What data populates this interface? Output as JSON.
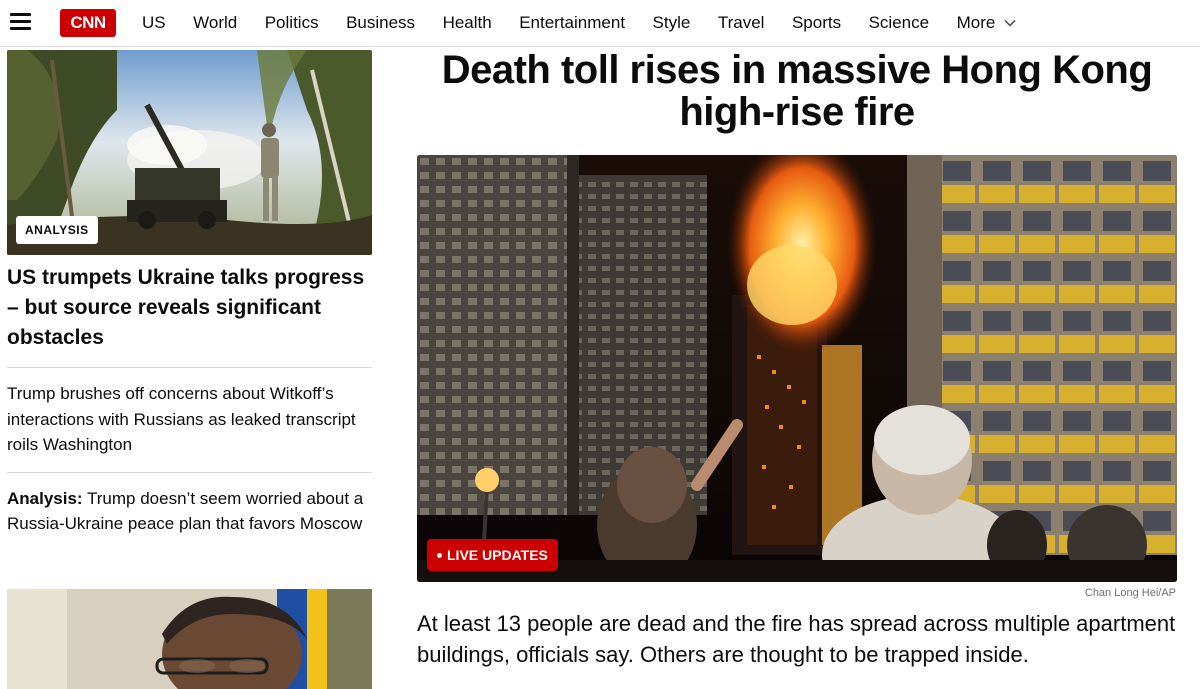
{
  "brand": {
    "color": "#cc0000",
    "logo_text": "CNN"
  },
  "nav": {
    "items": [
      "US",
      "World",
      "Politics",
      "Business",
      "Health",
      "Entertainment",
      "Style",
      "Travel",
      "Sports",
      "Science"
    ],
    "more_label": "More",
    "menu_icon": "hamburger-menu-icon",
    "more_icon": "chevron-down-icon"
  },
  "left_column": {
    "lead": {
      "badge": "ANALYSIS",
      "title": "US trumpets Ukraine talks progress – but source reveals significant obstacles"
    },
    "stories": [
      {
        "prefix": "",
        "text": "Trump brushes off concerns about Witkoff’s interactions with Russians as leaked transcript roils Washington"
      },
      {
        "prefix": "Analysis:",
        "text": " Trump doesn’t seem worried about a Russia-Ukraine peace plan that favors Moscow"
      }
    ]
  },
  "main": {
    "headline": "Death toll rises in massive Hong Kong high-rise fire",
    "live_label": "LIVE UPDATES",
    "photo_credit": "Chan Long Hei/AP",
    "summary": "At least 13 people are dead and the fire has spread across multiple apartment buildings, officials say. Others are thought to be trapped inside."
  }
}
